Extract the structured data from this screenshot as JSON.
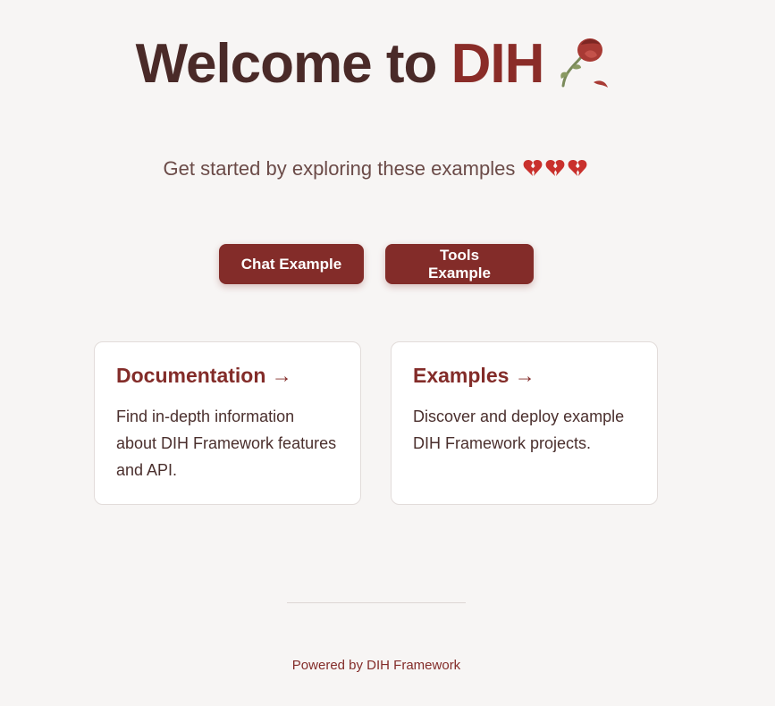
{
  "hero": {
    "title_prefix": "Welcome to ",
    "title_brand": "DIH",
    "icon": "wilted-rose-icon"
  },
  "subtitle": {
    "text": "Get started by exploring these examples",
    "icons": [
      "broken-heart-icon",
      "broken-heart-icon",
      "broken-heart-icon"
    ]
  },
  "buttons": {
    "chat_label": "Chat Example",
    "tools_label": "Tools Example"
  },
  "cards": [
    {
      "title": "Documentation →",
      "description": "Find in-depth information about DIH Framework features and API."
    },
    {
      "title": "Examples →",
      "description": "Discover and deploy example DIH Framework projects."
    }
  ],
  "footer": {
    "text": "Powered by DIH Framework"
  },
  "colors": {
    "background": "#f7f5f4",
    "accent": "#832c29",
    "heading": "#4a2a28",
    "card_background": "#ffffff"
  }
}
